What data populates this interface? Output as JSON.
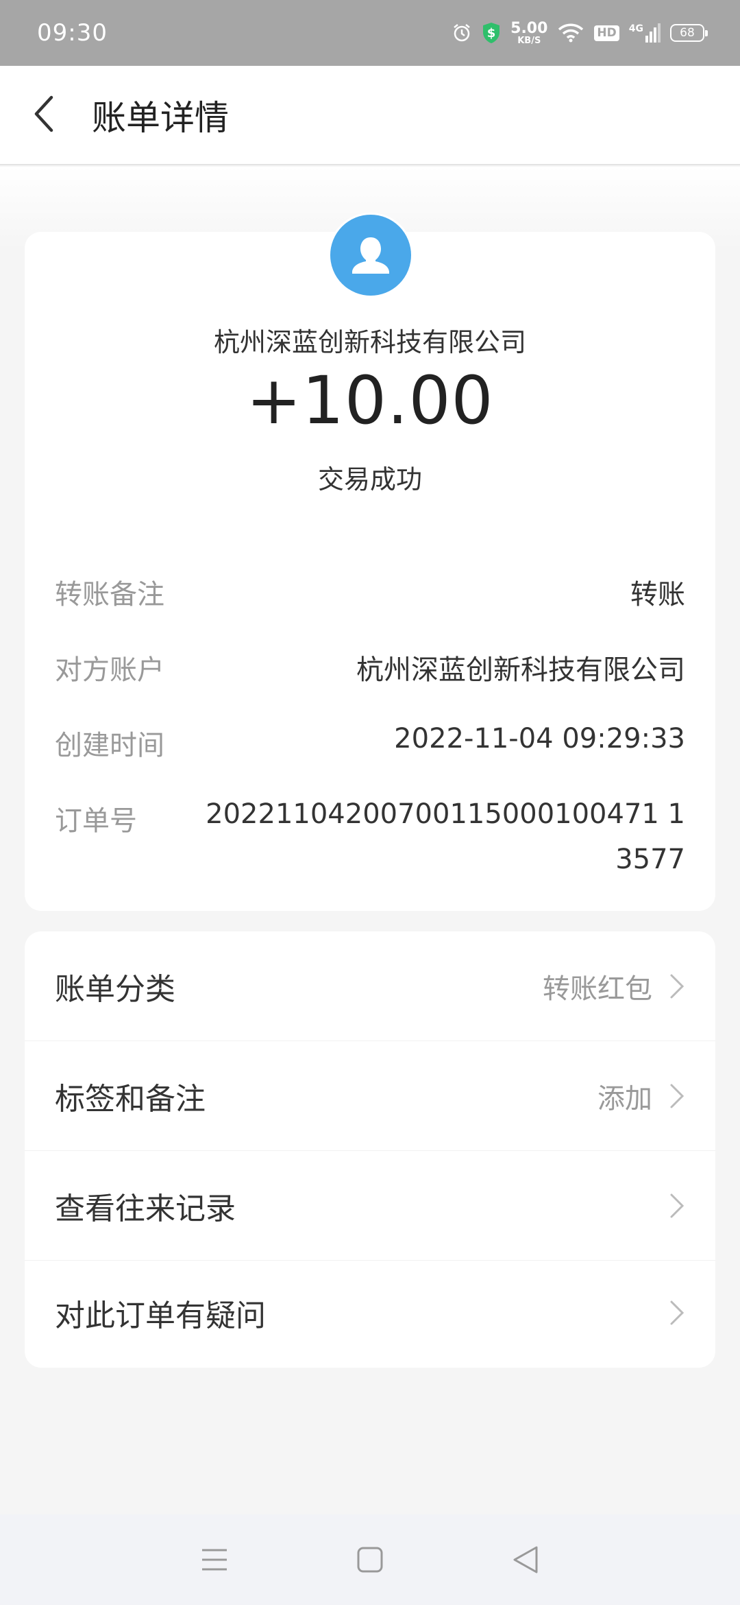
{
  "status_bar": {
    "time": "09:30",
    "speed_value": "5.00",
    "speed_unit": "KB/S",
    "hd_label": "HD",
    "network_label": "4G",
    "battery_level": "68",
    "icons": [
      "alarm-icon",
      "shield-icon",
      "wifi-icon",
      "signal-icon",
      "battery-icon"
    ]
  },
  "header": {
    "title": "账单详情",
    "back_icon": "chevron-left-icon"
  },
  "transaction": {
    "avatar_icon": "user-avatar-icon",
    "avatar_color": "#4aa8ea",
    "payee": "杭州深蓝创新科技有限公司",
    "amount": "+10.00",
    "status": "交易成功"
  },
  "details": [
    {
      "label": "转账备注",
      "value": "转账"
    },
    {
      "label": "对方账户",
      "value": "杭州深蓝创新科技有限公司"
    },
    {
      "label": "创建时间",
      "value": "2022-11-04 09:29:33"
    },
    {
      "label": "订单号",
      "value": "20221104200700115000100471 13577"
    }
  ],
  "actions": [
    {
      "label": "账单分类",
      "value": "转账红包"
    },
    {
      "label": "标签和备注",
      "value": "添加"
    },
    {
      "label": "查看往来记录",
      "value": ""
    },
    {
      "label": "对此订单有疑问",
      "value": ""
    }
  ],
  "system_nav": {
    "icons": [
      "menu-icon",
      "home-icon",
      "back-triangle-icon"
    ]
  }
}
